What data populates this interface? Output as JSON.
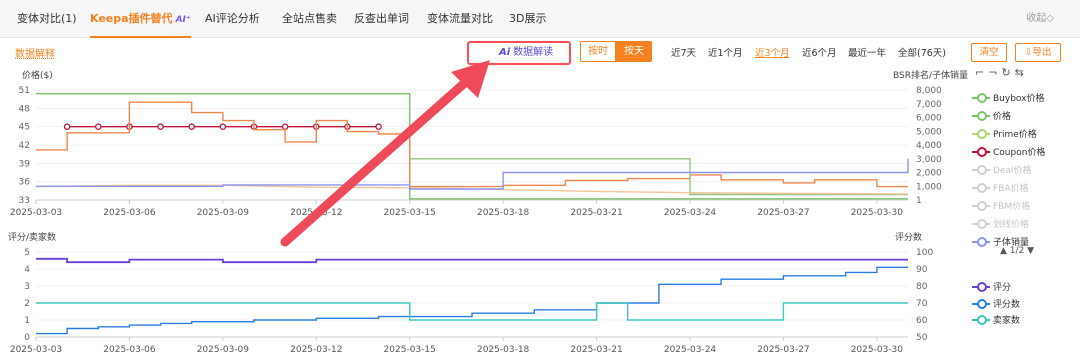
{
  "tabs": [
    {
      "label": "变体对比(1)",
      "active": false
    },
    {
      "label": "Keepa插件替代",
      "active": true,
      "badge": "AI⁺"
    },
    {
      "label": "AI评论分析",
      "active": false
    },
    {
      "label": "全站点售卖",
      "active": false
    },
    {
      "label": "反查出单词",
      "active": false
    },
    {
      "label": "变体流量对比",
      "active": false
    },
    {
      "label": "3D展示",
      "active": false
    }
  ],
  "collapse_label": "收起◇",
  "toolbar": {
    "data_explain": "数据解释",
    "ai_label": "Ai",
    "ai_button": "数据解读",
    "by_time": "按时",
    "by_day": "按天",
    "ranges": [
      "近7天",
      "近1个月",
      "近3个月",
      "近6个月",
      "最近一年",
      "全部(76天)"
    ],
    "active_range": "近3个月",
    "clear": "清空",
    "export": "导出"
  },
  "tool_icons": [
    "crop-icon",
    "crop-icon",
    "refresh-icon",
    "swap-icon"
  ],
  "legend": {
    "items": [
      {
        "label": "Buybox价格",
        "color": "#7cc46a",
        "faded": false
      },
      {
        "label": "价格",
        "color": "#7cc46a",
        "faded": false
      },
      {
        "label": "Prime价格",
        "color": "#a8d86e",
        "faded": false
      },
      {
        "label": "Coupon价格",
        "color": "#c0143c",
        "faded": false
      },
      {
        "label": "Deal价格",
        "color": "#d0d0d0",
        "faded": true
      },
      {
        "label": "FBA价格",
        "color": "#d0d0d0",
        "faded": true
      },
      {
        "label": "FBM价格",
        "color": "#d0d0d0",
        "faded": true
      },
      {
        "label": "划线价格",
        "color": "#d0d0d0",
        "faded": true
      },
      {
        "label": "子体销量",
        "color": "#8a96f0",
        "faded": false
      }
    ],
    "pager": "▲ 1/2 ▼",
    "bottom_items": [
      {
        "label": "评分",
        "color": "#6a3fd8"
      },
      {
        "label": "评分数",
        "color": "#2a7de1"
      },
      {
        "label": "卖家数",
        "color": "#3cc8c0"
      }
    ]
  },
  "chart_data": [
    {
      "type": "line",
      "ylabel_left": "价格($)",
      "ylabel_right": "BSR排名/子体销量",
      "ylim_left": [
        33,
        51
      ],
      "yticks_left": [
        33,
        36,
        39,
        42,
        45,
        48,
        51
      ],
      "ylim_right": [
        0,
        8000
      ],
      "yticks_right": [
        "1",
        "1,000",
        "2,000",
        "3,000",
        "4,000",
        "5,000",
        "6,000",
        "7,000",
        "8,000"
      ],
      "yticks_right_values": [
        1,
        1000,
        2000,
        3000,
        4000,
        5000,
        6000,
        7000,
        8000
      ],
      "x_start": "2025-03-03",
      "x_end": "2025-03-31",
      "xticks": [
        "2025-03-03",
        "2025-03-06",
        "2025-03-09",
        "2025-03-12",
        "2025-03-15",
        "2025-03-18",
        "2025-03-21",
        "2025-03-24",
        "2025-03-27",
        "2025-03-30"
      ],
      "series": [
        {
          "name": "价格",
          "axis": "left",
          "color": "#7cc46a",
          "step": true,
          "points": [
            [
              "2025-03-03",
              50.4
            ],
            [
              "2025-03-15",
              50.4
            ],
            [
              "2025-03-15",
              33.2
            ],
            [
              "2025-03-31",
              33.2
            ]
          ]
        },
        {
          "name": "Coupon价格",
          "axis": "left",
          "color": "#c0143c",
          "markers": true,
          "points": [
            [
              "2025-03-04",
              45
            ],
            [
              "2025-03-05",
              45
            ],
            [
              "2025-03-06",
              45
            ],
            [
              "2025-03-07",
              45
            ],
            [
              "2025-03-08",
              45
            ],
            [
              "2025-03-09",
              45
            ],
            [
              "2025-03-10",
              45
            ],
            [
              "2025-03-11",
              45
            ],
            [
              "2025-03-12",
              45
            ],
            [
              "2025-03-13",
              45
            ],
            [
              "2025-03-14",
              45
            ]
          ]
        },
        {
          "name": "",
          "axis": "left",
          "color": "#f0884a",
          "step": true,
          "points": [
            [
              "2025-03-03",
              41.2
            ],
            [
              "2025-03-04",
              41.2
            ],
            [
              "2025-03-04",
              44
            ],
            [
              "2025-03-06",
              44
            ],
            [
              "2025-03-06",
              49
            ],
            [
              "2025-03-08",
              49
            ],
            [
              "2025-03-08",
              47.3
            ],
            [
              "2025-03-09",
              47.3
            ],
            [
              "2025-03-09",
              46
            ],
            [
              "2025-03-10",
              46
            ],
            [
              "2025-03-10",
              44.5
            ],
            [
              "2025-03-11",
              44.5
            ],
            [
              "2025-03-11",
              42.5
            ],
            [
              "2025-03-12",
              42.5
            ],
            [
              "2025-03-12",
              46
            ],
            [
              "2025-03-13",
              46
            ],
            [
              "2025-03-13",
              44.2
            ],
            [
              "2025-03-14",
              44.2
            ],
            [
              "2025-03-14",
              43.8
            ],
            [
              "2025-03-15",
              43.8
            ],
            [
              "2025-03-15",
              35.2
            ],
            [
              "2025-03-18",
              35.2
            ],
            [
              "2025-03-18",
              35.4
            ],
            [
              "2025-03-20",
              35.4
            ],
            [
              "2025-03-20",
              36.2
            ],
            [
              "2025-03-22",
              36.2
            ],
            [
              "2025-03-22",
              36.5
            ],
            [
              "2025-03-24",
              36.5
            ],
            [
              "2025-03-24",
              37.1
            ],
            [
              "2025-03-25",
              37.1
            ],
            [
              "2025-03-25",
              36.3
            ],
            [
              "2025-03-27",
              36.3
            ],
            [
              "2025-03-27",
              35.8
            ],
            [
              "2025-03-28",
              35.8
            ],
            [
              "2025-03-28",
              36.3
            ],
            [
              "2025-03-30",
              36.3
            ],
            [
              "2025-03-30",
              35.2
            ],
            [
              "2025-03-31",
              35.2
            ]
          ]
        },
        {
          "name": "",
          "axis": "right",
          "color": "#96c480",
          "step": true,
          "points": [
            [
              "2025-03-15",
              3000
            ],
            [
              "2025-03-24",
              3000
            ],
            [
              "2025-03-24",
              400
            ],
            [
              "2025-03-31",
              400
            ]
          ]
        },
        {
          "name": "",
          "axis": "left",
          "color": "#f2c49a",
          "points": [
            [
              "2025-03-03",
              35.2
            ],
            [
              "2025-03-06",
              35.4
            ],
            [
              "2025-03-09",
              35.4
            ],
            [
              "2025-03-12",
              35.1
            ],
            [
              "2025-03-15",
              35
            ],
            [
              "2025-03-18",
              34.7
            ],
            [
              "2025-03-21",
              34.4
            ],
            [
              "2025-03-24",
              34.2
            ],
            [
              "2025-03-27",
              34.1
            ],
            [
              "2025-03-31",
              34
            ]
          ]
        },
        {
          "name": "子体销量",
          "axis": "right",
          "color": "#8a96f0",
          "step": true,
          "points": [
            [
              "2025-03-03",
              1000
            ],
            [
              "2025-03-09",
              1000
            ],
            [
              "2025-03-09",
              1100
            ],
            [
              "2025-03-15",
              1100
            ],
            [
              "2025-03-15",
              800
            ],
            [
              "2025-03-18",
              800
            ],
            [
              "2025-03-18",
              2000
            ],
            [
              "2025-03-31",
              2000
            ],
            [
              "2025-03-31",
              3000
            ]
          ]
        }
      ]
    },
    {
      "type": "line",
      "ylabel_left": "评分/卖家数",
      "ylabel_right": "评分数",
      "ylim_left": [
        0,
        5
      ],
      "yticks_left": [
        0,
        1,
        2,
        3,
        4,
        5
      ],
      "ylim_right": [
        50,
        100
      ],
      "yticks_right": [
        50,
        60,
        70,
        80,
        90,
        100
      ],
      "x_start": "2025-03-03",
      "x_end": "2025-03-31",
      "xticks": [
        "2025-03-03",
        "2025-03-06",
        "2025-03-09",
        "2025-03-12",
        "2025-03-15",
        "2025-03-18",
        "2025-03-21",
        "2025-03-24",
        "2025-03-27",
        "2025-03-30"
      ],
      "series": [
        {
          "name": "评分",
          "axis": "left",
          "color": "#6a3fd8",
          "step": true,
          "points": [
            [
              "2025-03-03",
              4.6
            ],
            [
              "2025-03-04",
              4.6
            ],
            [
              "2025-03-04",
              4.4
            ],
            [
              "2025-03-06",
              4.4
            ],
            [
              "2025-03-06",
              4.55
            ],
            [
              "2025-03-09",
              4.55
            ],
            [
              "2025-03-09",
              4.4
            ],
            [
              "2025-03-12",
              4.4
            ],
            [
              "2025-03-12",
              4.55
            ],
            [
              "2025-03-31",
              4.55
            ]
          ]
        },
        {
          "name": "评分数",
          "axis": "right",
          "color": "#2a7de1",
          "step": true,
          "points": [
            [
              "2025-03-03",
              52
            ],
            [
              "2025-03-04",
              52
            ],
            [
              "2025-03-04",
              55
            ],
            [
              "2025-03-05",
              55
            ],
            [
              "2025-03-05",
              56
            ],
            [
              "2025-03-06",
              56
            ],
            [
              "2025-03-06",
              57
            ],
            [
              "2025-03-07",
              57
            ],
            [
              "2025-03-07",
              58
            ],
            [
              "2025-03-08",
              58
            ],
            [
              "2025-03-08",
              59
            ],
            [
              "2025-03-10",
              59
            ],
            [
              "2025-03-10",
              60
            ],
            [
              "2025-03-12",
              60
            ],
            [
              "2025-03-12",
              61
            ],
            [
              "2025-03-14",
              61
            ],
            [
              "2025-03-14",
              62
            ],
            [
              "2025-03-17",
              62
            ],
            [
              "2025-03-17",
              64
            ],
            [
              "2025-03-19",
              64
            ],
            [
              "2025-03-19",
              66
            ],
            [
              "2025-03-21",
              66
            ],
            [
              "2025-03-21",
              70
            ],
            [
              "2025-03-23",
              70
            ],
            [
              "2025-03-23",
              81
            ],
            [
              "2025-03-25",
              81
            ],
            [
              "2025-03-25",
              84
            ],
            [
              "2025-03-27",
              84
            ],
            [
              "2025-03-27",
              86
            ],
            [
              "2025-03-29",
              86
            ],
            [
              "2025-03-29",
              88
            ],
            [
              "2025-03-30",
              88
            ],
            [
              "2025-03-30",
              91
            ],
            [
              "2025-03-31",
              91
            ]
          ]
        },
        {
          "name": "卖家数",
          "axis": "left",
          "color": "#3cc8c0",
          "step": true,
          "points": [
            [
              "2025-03-03",
              2
            ],
            [
              "2025-03-15",
              2
            ],
            [
              "2025-03-15",
              1
            ],
            [
              "2025-03-21",
              1
            ],
            [
              "2025-03-21",
              2
            ],
            [
              "2025-03-22",
              2
            ],
            [
              "2025-03-22",
              1
            ],
            [
              "2025-03-27",
              1
            ],
            [
              "2025-03-27",
              2
            ],
            [
              "2025-03-31",
              2
            ]
          ]
        }
      ]
    }
  ]
}
